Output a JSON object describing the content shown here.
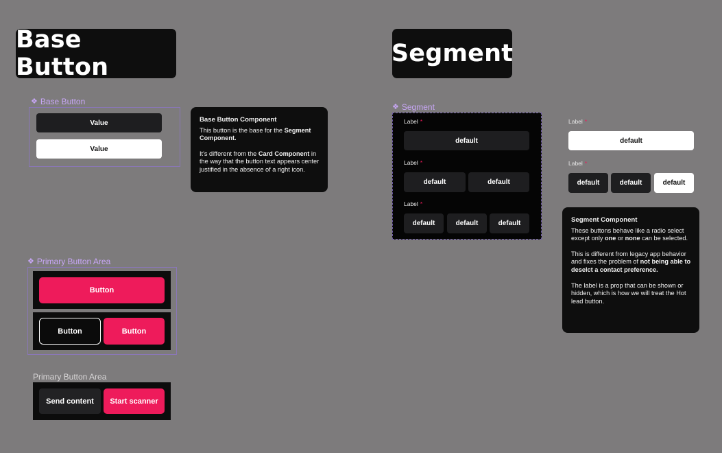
{
  "titles": {
    "base_button": "Base Button",
    "segment": "Segment"
  },
  "base_button_component": {
    "label": "Base Button",
    "icon": "component-diamond-icon",
    "buttons": [
      {
        "label": "Value",
        "variant": "dark"
      },
      {
        "label": "Value",
        "variant": "light"
      }
    ]
  },
  "base_button_card": {
    "title": "Base Button Component",
    "p1_text": "This button is the base for the ",
    "p1_bold": "Segment Component.",
    "p2_a": "It's different from the ",
    "p2_b": "Card Component",
    "p2_c": " in the way that the button text appears center justified in the absence of a right icon."
  },
  "primary_button_area_component": {
    "label": "Primary Button Area",
    "row1": {
      "button": "Button"
    },
    "row2": {
      "outline_button": "Button",
      "primary_button": "Button"
    }
  },
  "primary_button_area_instance": {
    "label": "Primary Button Area",
    "secondary_button": "Send content",
    "primary_button": "Start scanner"
  },
  "segment_component": {
    "label": "Segment",
    "groups": [
      {
        "label": "Label",
        "required_mark": "*",
        "options": [
          "default"
        ]
      },
      {
        "label": "Label",
        "required_mark": "*",
        "options": [
          "default",
          "default"
        ]
      },
      {
        "label": "Label",
        "required_mark": "*",
        "options": [
          "default",
          "default",
          "default"
        ]
      }
    ]
  },
  "segment_example": {
    "groups": [
      {
        "label": "Label",
        "required_mark": "*",
        "options": [
          {
            "text": "default",
            "selected": true
          }
        ]
      },
      {
        "label": "Label",
        "required_mark": "*",
        "options": [
          {
            "text": "default",
            "selected": false
          },
          {
            "text": "default",
            "selected": false
          },
          {
            "text": "default",
            "selected": true
          }
        ]
      }
    ]
  },
  "segment_card": {
    "title": "Segment Component",
    "p1_a": "These buttons behave like a radio select except only ",
    "p1_one": "one",
    "p1_or": " or ",
    "p1_none": "none",
    "p1_b": " can be selected.",
    "p2_a": "This is different from legacy app behavior and fixes the problem of ",
    "p2_bold": "not being able to deselct a contact preference.",
    "p3": "The label is a prop that can be shown or hidden, which is how we will treat the Hot lead button."
  },
  "colors": {
    "canvas": "#7d7b7c",
    "surface": "#0e0e0e",
    "accent_pink": "#ee1b5b",
    "component_purple": "#c7a6f5",
    "button_dark": "#1e1e20",
    "button_light": "#ffffff"
  }
}
